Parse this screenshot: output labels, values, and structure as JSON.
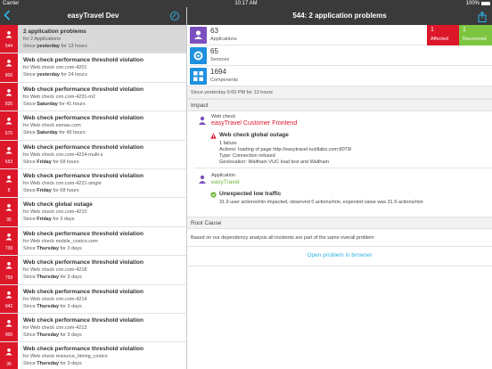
{
  "status_bar": {
    "carrier": "Carrier",
    "time": "10:17 AM",
    "battery": "100%"
  },
  "left_nav": {
    "title": "easyTravel Dev"
  },
  "right_nav": {
    "title": "544: 2 application problems"
  },
  "problems": [
    {
      "count": "544",
      "title": "2 application problems",
      "subtitle": "for 2 Applications",
      "since_prefix": "Since",
      "since_bold": "yesterday",
      "since_suffix": "for 13 hours",
      "selected": true
    },
    {
      "count": "800",
      "title": "Web check performance threshold violation",
      "subtitle": "for Web check cnn.com-4201",
      "since_prefix": "Since",
      "since_bold": "yesterday",
      "since_suffix": "for 24 hours"
    },
    {
      "count": "835",
      "title": "Web check performance threshold violation",
      "subtitle": "for Web check cnn.com-4231-m2",
      "since_prefix": "Since",
      "since_bold": "Saturday",
      "since_suffix": "for 41 hours"
    },
    {
      "count": "670",
      "title": "Web check performance threshold violation",
      "subtitle": "for Web check esmax.com",
      "since_prefix": "Since",
      "since_bold": "Saturday",
      "since_suffix": "for 49 hours"
    },
    {
      "count": "653",
      "title": "Web check performance threshold violation",
      "subtitle": "for Web check cnn.com-4224-multi-s",
      "since_prefix": "Since",
      "since_bold": "Friday",
      "since_suffix": "for 68 hours"
    },
    {
      "count": "8",
      "title": "Web check performance threshold violation",
      "subtitle": "for Web check cnn.com-4221-single",
      "since_prefix": "Since",
      "since_bold": "Friday",
      "since_suffix": "for 68 hours"
    },
    {
      "count": "95",
      "title": "Web check global outage",
      "subtitle": "for Web check cnn.com-4210",
      "since_prefix": "Since",
      "since_bold": "Friday",
      "since_suffix": "for 3 days"
    },
    {
      "count": "739",
      "title": "Web check performance threshold violation",
      "subtitle": "for Web check mobile_costco.com",
      "since_prefix": "Since",
      "since_bold": "Thursday",
      "since_suffix": "for 3 days"
    },
    {
      "count": "759",
      "title": "Web check performance threshold violation",
      "subtitle": "for Web check cnn.com-4218",
      "since_prefix": "Since",
      "since_bold": "Thursday",
      "since_suffix": "for 3 days"
    },
    {
      "count": "942",
      "title": "Web check performance threshold violation",
      "subtitle": "for Web check cnn.com-4214",
      "since_prefix": "Since",
      "since_bold": "Thursday",
      "since_suffix": "for 3 days"
    },
    {
      "count": "900",
      "title": "Web check performance threshold violation",
      "subtitle": "for Web check cnn.com-4213",
      "since_prefix": "Since",
      "since_bold": "Thursday",
      "since_suffix": "for 3 days"
    },
    {
      "count": "36",
      "title": "Web check performance threshold violation",
      "subtitle": "for Web check resource_timing_costco",
      "since_prefix": "Since",
      "since_bold": "Thursday",
      "since_suffix": "for 3 days"
    }
  ],
  "summary": {
    "applications": {
      "value": "63",
      "label": "Applications"
    },
    "services": {
      "value": "65",
      "label": "Services"
    },
    "components": {
      "value": "1694",
      "label": "Components"
    },
    "affected": {
      "value": "1",
      "label": "Affected"
    },
    "recovered": {
      "value": "1",
      "label": "Recovered"
    }
  },
  "since_text": "Since yesterday 9:00 PM for 13 hours",
  "impact": {
    "header": "Impact",
    "web_check": {
      "type_label": "Web check",
      "name": "easyTravel Customer Frontend",
      "event_title": "Web check global outage",
      "lines": [
        "1 failure",
        "Actions: loading of page http://easytravel.ruxitlabs.com:8079/",
        "Type: Connection refused",
        "Geolocation: Waltham VUC load test and Waltham"
      ]
    },
    "application": {
      "type_label": "Application",
      "name": "easyTravel",
      "event_title": "Unexpected low traffic",
      "lines": [
        "31.9 user actions/min impacted, observed 0 actions/min, expected value was 31.9 actions/min"
      ]
    }
  },
  "root_cause": {
    "header": "Root Cause",
    "text": "Based on our dependency analysis all incidents are part of the same overall problem"
  },
  "open_browser_label": "Open problem in browser",
  "colors": {
    "accent": "#2eb3e8",
    "problem_red": "#dc172a",
    "recovered_green": "#7dc540",
    "app_purple": "#7c4fbf",
    "service_blue": "#1e90e0"
  },
  "icons": [
    "back-chevron-icon",
    "compass-icon",
    "share-icon",
    "person-icon",
    "application-icon",
    "service-icon",
    "components-icon",
    "warning-icon",
    "check-circle-icon"
  ]
}
